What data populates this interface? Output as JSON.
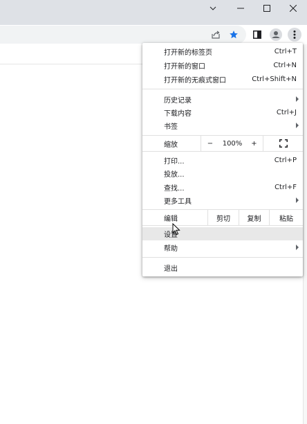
{
  "window_controls": {
    "tab_search_icon": "chevron-down-icon",
    "minimize_icon": "minimize-icon",
    "maximize_icon": "maximize-icon",
    "close_icon": "close-icon"
  },
  "toolbar": {
    "share_icon": "share-icon",
    "bookmark_icon": "star-icon",
    "side_panel_icon": "side-panel-icon",
    "profile_icon": "profile-icon",
    "menu_icon": "more-vert-icon",
    "accent_color": "#1a73e8"
  },
  "menu": {
    "new_tab": {
      "label": "打开新的标签页",
      "shortcut": "Ctrl+T"
    },
    "new_window": {
      "label": "打开新的窗口",
      "shortcut": "Ctrl+N"
    },
    "new_incognito": {
      "label": "打开新的无痕式窗口",
      "shortcut": "Ctrl+Shift+N"
    },
    "history": {
      "label": "历史记录"
    },
    "downloads": {
      "label": "下载内容",
      "shortcut": "Ctrl+J"
    },
    "bookmarks": {
      "label": "书签"
    },
    "zoom": {
      "label": "缩放",
      "minus": "−",
      "value": "100%",
      "plus": "+"
    },
    "print": {
      "label": "打印...",
      "shortcut": "Ctrl+P"
    },
    "cast": {
      "label": "投放..."
    },
    "find": {
      "label": "查找...",
      "shortcut": "Ctrl+F"
    },
    "more_tools": {
      "label": "更多工具"
    },
    "edit": {
      "label": "编辑",
      "cut": "剪切",
      "copy": "复制",
      "paste": "粘贴"
    },
    "settings": {
      "label": "设置"
    },
    "help": {
      "label": "帮助"
    },
    "exit": {
      "label": "退出"
    }
  }
}
